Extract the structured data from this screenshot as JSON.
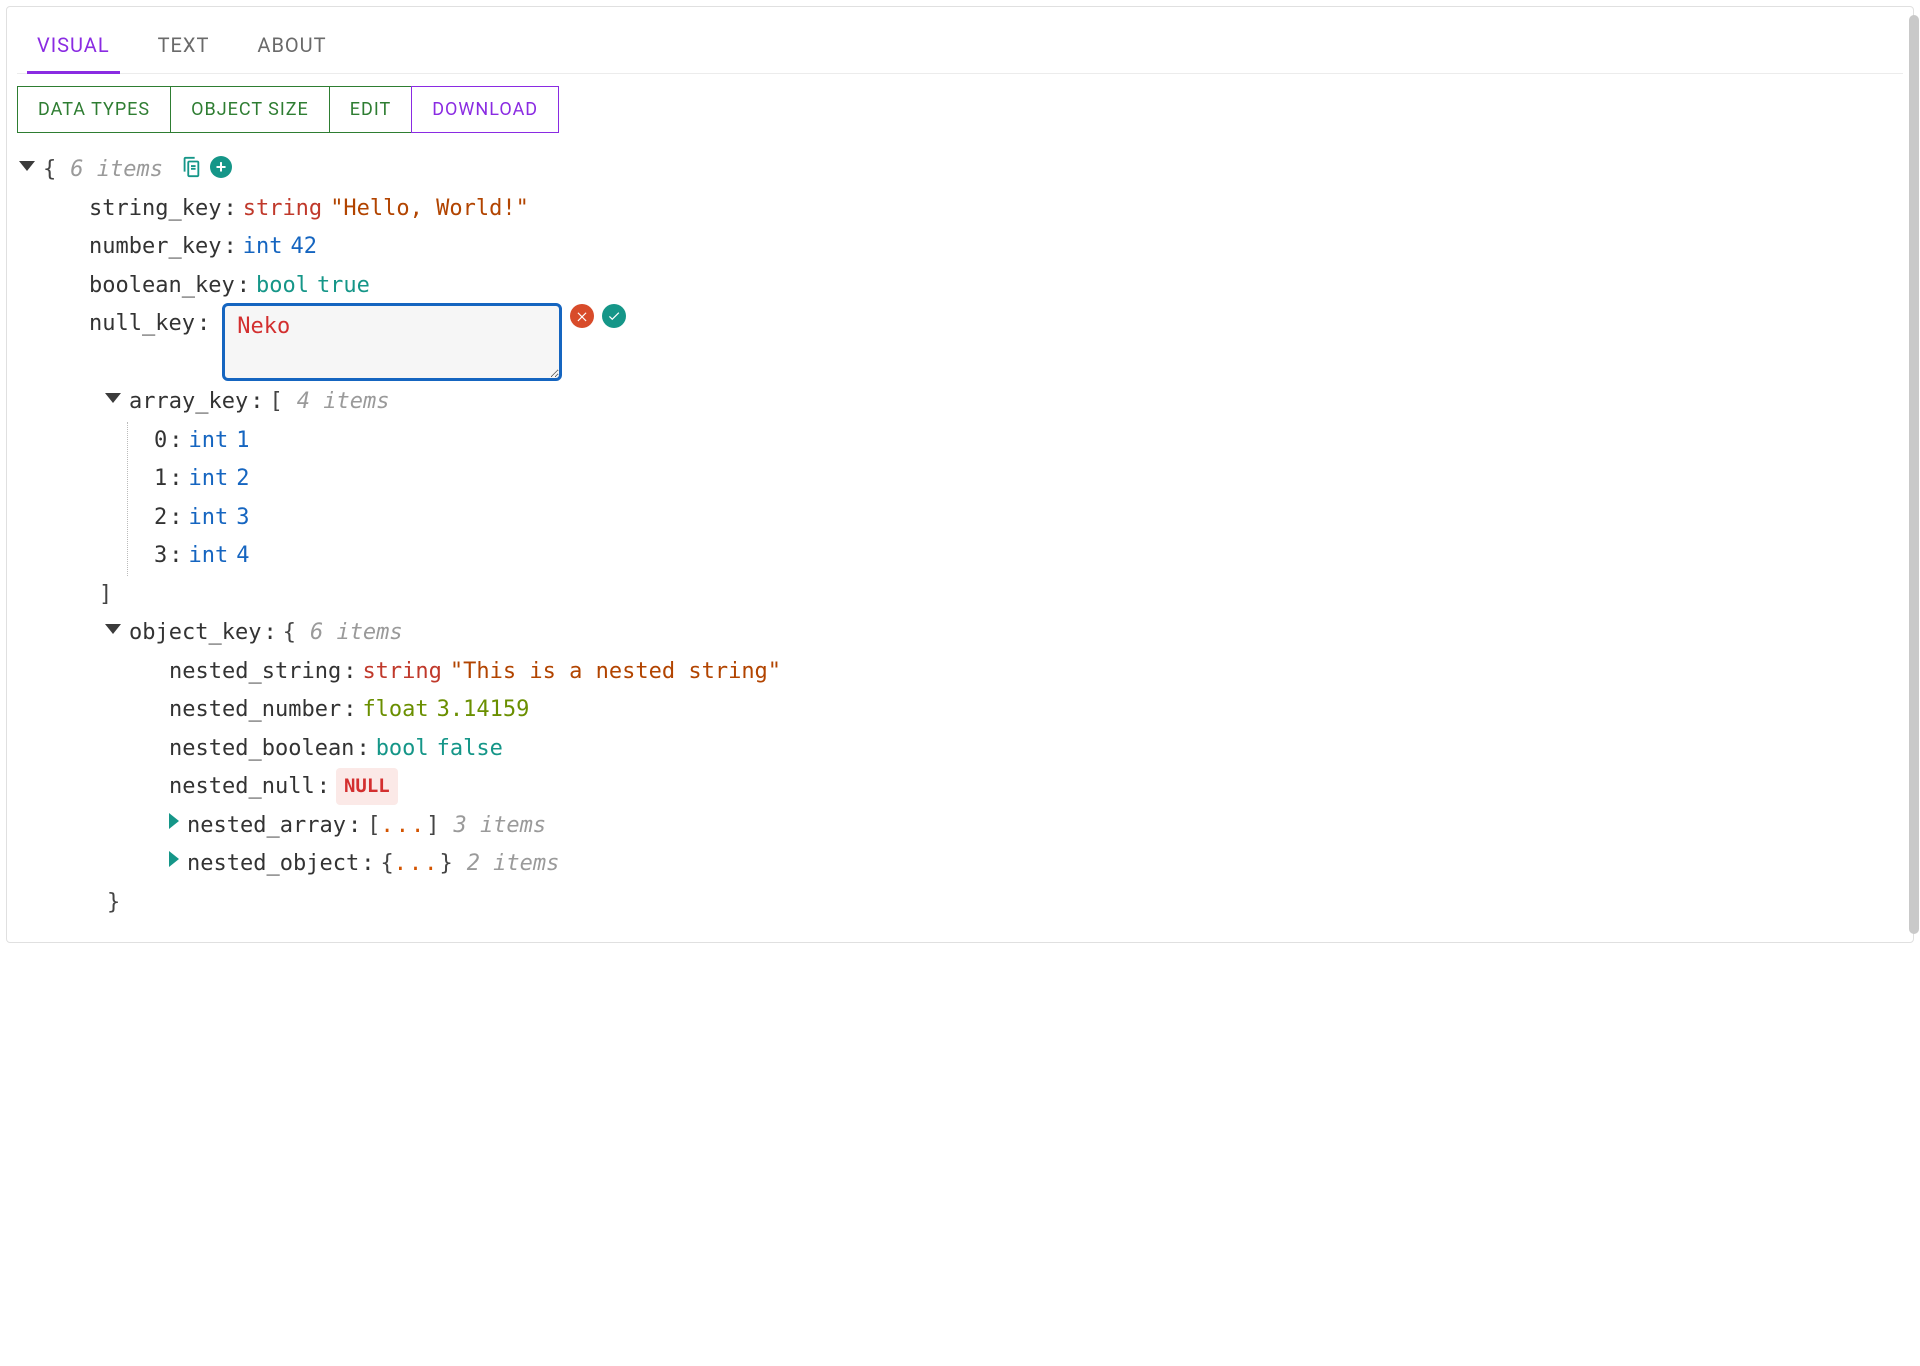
{
  "tabs": {
    "visual": "VISUAL",
    "text": "TEXT",
    "about": "ABOUT"
  },
  "buttons": {
    "data_types": "DATA TYPES",
    "object_size": "OBJECT SIZE",
    "edit": "EDIT",
    "download": "DOWNLOAD"
  },
  "labels": {
    "items6": "6 items",
    "items4": "4 items",
    "items3": "3 items",
    "items2": "2 items",
    "open_brace": "{",
    "close_brace": "}",
    "open_bracket": "[",
    "close_bracket": "]",
    "dots": "...",
    "null_badge": "NULL"
  },
  "types": {
    "string": "string",
    "int": "int",
    "bool": "bool",
    "float": "float"
  },
  "root": {
    "string_key": {
      "key": "string_key",
      "value": "\"Hello, World!\""
    },
    "number_key": {
      "key": "number_key",
      "value": "42"
    },
    "boolean_key": {
      "key": "boolean_key",
      "value": "true"
    },
    "null_key": {
      "key": "null_key",
      "edit_value": "Neko"
    },
    "array_key": {
      "key": "array_key",
      "items": [
        {
          "idx": "0",
          "value": "1"
        },
        {
          "idx": "1",
          "value": "2"
        },
        {
          "idx": "2",
          "value": "3"
        },
        {
          "idx": "3",
          "value": "4"
        }
      ]
    },
    "object_key": {
      "key": "object_key",
      "nested_string": {
        "key": "nested_string",
        "value": "\"This is a nested string\""
      },
      "nested_number": {
        "key": "nested_number",
        "value": "3.14159"
      },
      "nested_boolean": {
        "key": "nested_boolean",
        "value": "false"
      },
      "nested_null": {
        "key": "nested_null"
      },
      "nested_array": {
        "key": "nested_array"
      },
      "nested_object": {
        "key": "nested_object"
      }
    }
  }
}
